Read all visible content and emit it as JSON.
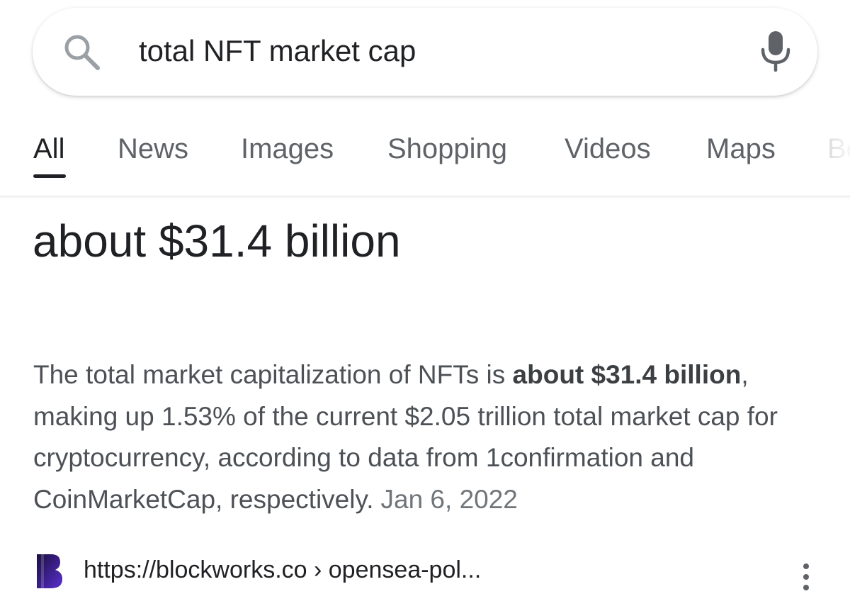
{
  "search": {
    "query": "total NFT market cap"
  },
  "tabs": [
    {
      "label": "All",
      "active": true
    },
    {
      "label": "News"
    },
    {
      "label": "Images"
    },
    {
      "label": "Shopping"
    },
    {
      "label": "Videos"
    },
    {
      "label": "Maps"
    }
  ],
  "tab_more_partial": "Bo",
  "answer": {
    "text": "about $31.4 billion"
  },
  "snippet": {
    "text_before": "The total market capitalization of NFTs is ",
    "bold": "about $31.4 billion",
    "text_after": ", making up 1.53% of the current $2.05 trillion total market cap for cryptocurrency, according to data from 1confirmation and CoinMarketCap, respectively.",
    "date": "Jan 6, 2022"
  },
  "source": {
    "url": "https://blockworks.co › opensea-pol..."
  },
  "icons": {
    "search": "search-icon",
    "mic": "mic-icon",
    "source_logo": "blockworks-logo-icon",
    "more": "more-vert-icon"
  },
  "colors": {
    "text_primary": "#202124",
    "text_secondary": "#5f6368",
    "snippet_text": "#4d5156",
    "logo_purple": "#3a1f8a"
  }
}
